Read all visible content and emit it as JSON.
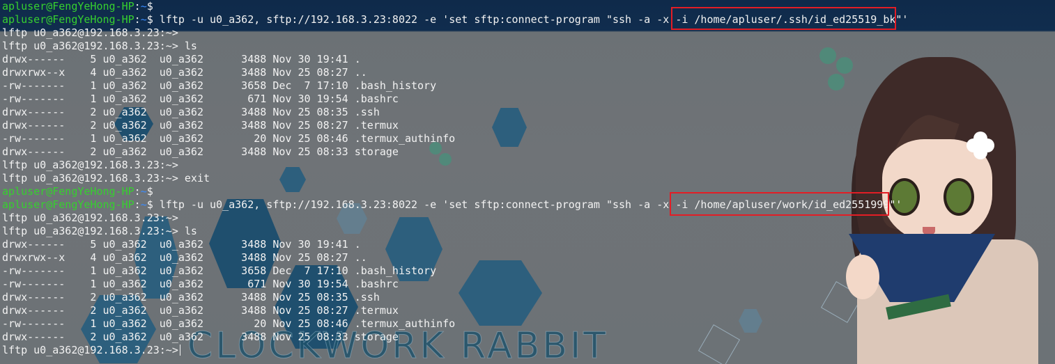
{
  "session_1": {
    "prompt_user": "apluser@FengYeHong-HP",
    "prompt_colon": ":",
    "prompt_path": "~",
    "prompt_dollar": "$",
    "command_prefix": " lftp -u u0_a362, sftp://192.168.3.23:8022 -e 'set sftp:connect-program \"ssh -a -x ",
    "command_highlight": "-i /home/apluser/.ssh/id_ed25519_bk",
    "command_suffix": "\"'"
  },
  "output_1": [
    "lftp u0_a362@192.168.3.23:~>",
    "lftp u0_a362@192.168.3.23:~> ls",
    "drwx------    5 u0_a362  u0_a362      3488 Nov 30 19:41 .",
    "drwxrwx--x    4 u0_a362  u0_a362      3488 Nov 25 08:27 ..",
    "-rw-------    1 u0_a362  u0_a362      3658 Dec  7 17:10 .bash_history",
    "-rw-------    1 u0_a362  u0_a362       671 Nov 30 19:54 .bashrc",
    "drwx------    2 u0_a362  u0_a362      3488 Nov 25 08:35 .ssh",
    "drwx------    2 u0_a362  u0_a362      3488 Nov 25 08:27 .termux",
    "-rw-------    1 u0_a362  u0_a362        20 Nov 25 08:46 .termux_authinfo",
    "drwx------    2 u0_a362  u0_a362      3488 Nov 25 08:33 storage",
    "lftp u0_a362@192.168.3.23:~>",
    "lftp u0_a362@192.168.3.23:~> exit"
  ],
  "session_2_empty": {
    "prompt_user": "apluser@FengYeHong-HP",
    "prompt_colon": ":",
    "prompt_path": "~",
    "prompt_dollar": "$"
  },
  "session_2": {
    "prompt_user": "apluser@FengYeHong-HP",
    "prompt_colon": ":",
    "prompt_path": "~",
    "prompt_dollar": "$",
    "command_prefix": " lftp -u u0_a362, sftp://192.168.3.23:8022 -e 'set sftp:connect-program \"ssh -a -x ",
    "command_highlight": "-i /home/apluser/work/id_ed2551999",
    "command_suffix": "\"'"
  },
  "output_2": [
    "lftp u0_a362@192.168.3.23:~>",
    "lftp u0_a362@192.168.3.23:~> ls",
    "drwx------    5 u0_a362  u0_a362      3488 Nov 30 19:41 .",
    "drwxrwx--x    4 u0_a362  u0_a362      3488 Nov 25 08:27 ..",
    "-rw-------    1 u0_a362  u0_a362      3658 Dec  7 17:10 .bash_history",
    "-rw-------    1 u0_a362  u0_a362       671 Nov 30 19:54 .bashrc",
    "drwx------    2 u0_a362  u0_a362      3488 Nov 25 08:35 .ssh",
    "drwx------    2 u0_a362  u0_a362      3488 Nov 25 08:27 .termux",
    "-rw-------    1 u0_a362  u0_a362        20 Nov 25 08:46 .termux_authinfo",
    "drwx------    2 u0_a362  u0_a362      3488 Nov 25 08:33 storage"
  ],
  "current_prompt": "lftp u0_a362@192.168.3.23:~>",
  "watermark": "CLOCKWORK RABBIT",
  "colors": {
    "prompt_user": "#36d02f",
    "prompt_path": "#3a8cff",
    "text": "#f2f2f2",
    "highlight_border": "#e31d25"
  }
}
